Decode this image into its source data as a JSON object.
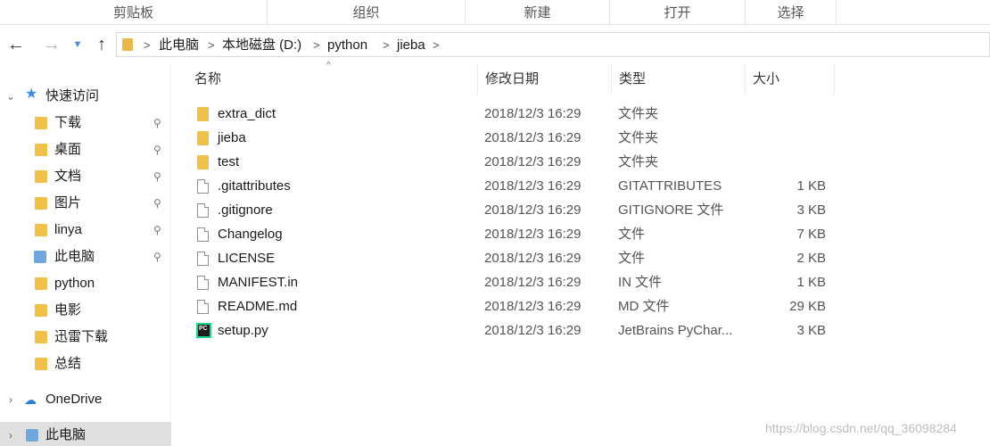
{
  "ribbon": {
    "groups": [
      "剪贴板",
      "组织",
      "新建",
      "打开",
      "选择"
    ]
  },
  "navigation": {
    "back_icon": "arrow-left-icon",
    "forward_icon": "arrow-right-icon",
    "recent_icon": "chevron-down-icon",
    "up_icon": "arrow-up-icon"
  },
  "address_bar": {
    "crumbs": [
      "此电脑",
      "本地磁盘 (D:)",
      "python",
      "jieba"
    ],
    "separator": ">"
  },
  "sidebar": {
    "quick_access": "快速访问",
    "items": [
      {
        "label": "下载",
        "pinned": true,
        "icon": "downloads-folder-icon"
      },
      {
        "label": "桌面",
        "pinned": true,
        "icon": "desktop-folder-icon"
      },
      {
        "label": "文档",
        "pinned": true,
        "icon": "documents-folder-icon"
      },
      {
        "label": "图片",
        "pinned": true,
        "icon": "pictures-folder-icon"
      },
      {
        "label": "linya",
        "pinned": true,
        "icon": "folder-icon"
      },
      {
        "label": "此电脑",
        "pinned": true,
        "icon": "computer-icon"
      },
      {
        "label": "python",
        "pinned": false,
        "icon": "folder-icon"
      },
      {
        "label": "电影",
        "pinned": false,
        "icon": "folder-icon"
      },
      {
        "label": "迅雷下载",
        "pinned": false,
        "icon": "folder-icon"
      },
      {
        "label": "总结",
        "pinned": false,
        "icon": "folder-icon"
      }
    ],
    "onedrive": "OneDrive",
    "this_pc": "此电脑",
    "pin_symbol": "📌",
    "expanded_chevron": "⌄",
    "collapsed_chevron": "›"
  },
  "columns": {
    "name": "名称",
    "date": "修改日期",
    "type": "类型",
    "size": "大小",
    "sort_indicator": "^"
  },
  "files": [
    {
      "name": "extra_dict",
      "date": "2018/12/3 16:29",
      "type": "文件夹",
      "size": "",
      "icon": "folder"
    },
    {
      "name": "jieba",
      "date": "2018/12/3 16:29",
      "type": "文件夹",
      "size": "",
      "icon": "folder"
    },
    {
      "name": "test",
      "date": "2018/12/3 16:29",
      "type": "文件夹",
      "size": "",
      "icon": "folder"
    },
    {
      "name": ".gitattributes",
      "date": "2018/12/3 16:29",
      "type": "GITATTRIBUTES",
      "size": "1 KB",
      "icon": "doc"
    },
    {
      "name": ".gitignore",
      "date": "2018/12/3 16:29",
      "type": "GITIGNORE 文件",
      "size": "3 KB",
      "icon": "doc"
    },
    {
      "name": "Changelog",
      "date": "2018/12/3 16:29",
      "type": "文件",
      "size": "7 KB",
      "icon": "doc"
    },
    {
      "name": "LICENSE",
      "date": "2018/12/3 16:29",
      "type": "文件",
      "size": "2 KB",
      "icon": "doc"
    },
    {
      "name": "MANIFEST.in",
      "date": "2018/12/3 16:29",
      "type": "IN 文件",
      "size": "1 KB",
      "icon": "doc"
    },
    {
      "name": "README.md",
      "date": "2018/12/3 16:29",
      "type": "MD 文件",
      "size": "29 KB",
      "icon": "doc"
    },
    {
      "name": "setup.py",
      "date": "2018/12/3 16:29",
      "type": "JetBrains PyChar...",
      "size": "3 KB",
      "icon": "py"
    }
  ],
  "pycharm_badge": "PC",
  "watermark": "https://blog.csdn.net/qq_36098284",
  "colors": {
    "folder": "#f0c14a",
    "accent": "#3d8ee8",
    "selected_bg": "#e0e0e0"
  }
}
